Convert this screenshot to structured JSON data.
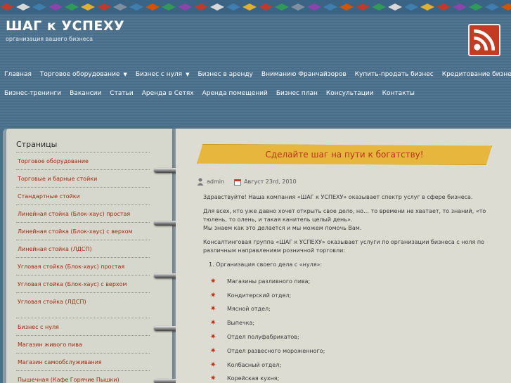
{
  "header": {
    "site_title": "ШАГ к УСПЕХУ",
    "site_subtitle": "организация вашего бизнеса",
    "ornament_colors": [
      "#c0392b",
      "#d8d8d8",
      "#3f7fb0",
      "#8e44ad",
      "#2f9a5a",
      "#e0b030",
      "#c0392b",
      "#7f8fa0",
      "#3f7fb0",
      "#d35400",
      "#2f9a5a",
      "#8e44ad",
      "#c0392b",
      "#d8d8d8",
      "#3f7fb0",
      "#e0b030",
      "#c0392b",
      "#2f9a5a",
      "#7f8fa0",
      "#8e44ad",
      "#3f7fb0",
      "#d35400",
      "#c0392b",
      "#2f9a5a",
      "#d8d8d8",
      "#3f7fb0",
      "#e0b030",
      "#c0392b",
      "#8e44ad",
      "#2f9a5a",
      "#3f7fb0",
      "#d35400"
    ]
  },
  "nav": {
    "row1": [
      {
        "label": "Главная",
        "dropdown": false
      },
      {
        "label": "Торговое оборудование",
        "dropdown": true
      },
      {
        "label": "Бизнес с нуля",
        "dropdown": true
      },
      {
        "label": "Бизнес в аренду",
        "dropdown": false
      },
      {
        "label": "Вниманию Франчайзоров",
        "dropdown": false
      },
      {
        "label": "Купить-продать бизнес",
        "dropdown": false
      },
      {
        "label": "Кредитование бизнеса",
        "dropdown": false
      }
    ],
    "row2": [
      {
        "label": "Бизнес-тренинги"
      },
      {
        "label": "Вакансии"
      },
      {
        "label": "Статьи"
      },
      {
        "label": "Аренда в Сетях"
      },
      {
        "label": "Аренда помещений"
      },
      {
        "label": "Бизнес план"
      },
      {
        "label": "Консультации"
      },
      {
        "label": "Контакты"
      }
    ]
  },
  "sidebar": {
    "heading": "Страницы",
    "group1": [
      "Торговое оборудование",
      "Торговые и барные стойки",
      "Стандартные стойки",
      "Линейная стойка (Блок-хаус) простая",
      "Линейная стойка (Блок-хаус) с верхом",
      "Линейная стойка (ЛДСП)",
      "Угловая стойка (Блок-хаус) простая",
      "Угловая стойка (Блок-хаус) с верхом",
      "Угловая стойка (ЛДСП)"
    ],
    "group2": [
      "Бизнес с нуля",
      "Магазин живого пива",
      "Магазин самообслуживания",
      "Пышечная (Кафе Горячие Пышки)"
    ]
  },
  "post": {
    "banner": "Сделайте шаг на пути к богатству!",
    "author": "admin",
    "date": "Август 23rd, 2010",
    "p1": "Здравствуйте! Наша компания «ШАГ к УСПЕХУ» оказывает спектр услуг в сфере бизнеса.",
    "p2a": "Для всех, кто уже давно хочет открыть свое дело, но… то времени не хватает, то знаний, «то тюлень, то олень, и такая канитель целый день».",
    "p2b": "Мы знаем как это делается и мы можем помочь Вам.",
    "p3": "Консалтинговая группа «ШАГ к УСПЕХУ» оказывает услуги по организации бизнеса с ноля по различным направлениям розничной торговли:",
    "list_head": "1. Организация своего дела с «нуля»:",
    "list": [
      "Магазины разливного пива;",
      "Кондитерский отдел;",
      "Мясной отдел;",
      "Выпечка;",
      "Отдел полуфабрикатов;",
      "Отдел развесного мороженного;",
      "Колбасный отдел;",
      "Корейская кухня;"
    ]
  }
}
